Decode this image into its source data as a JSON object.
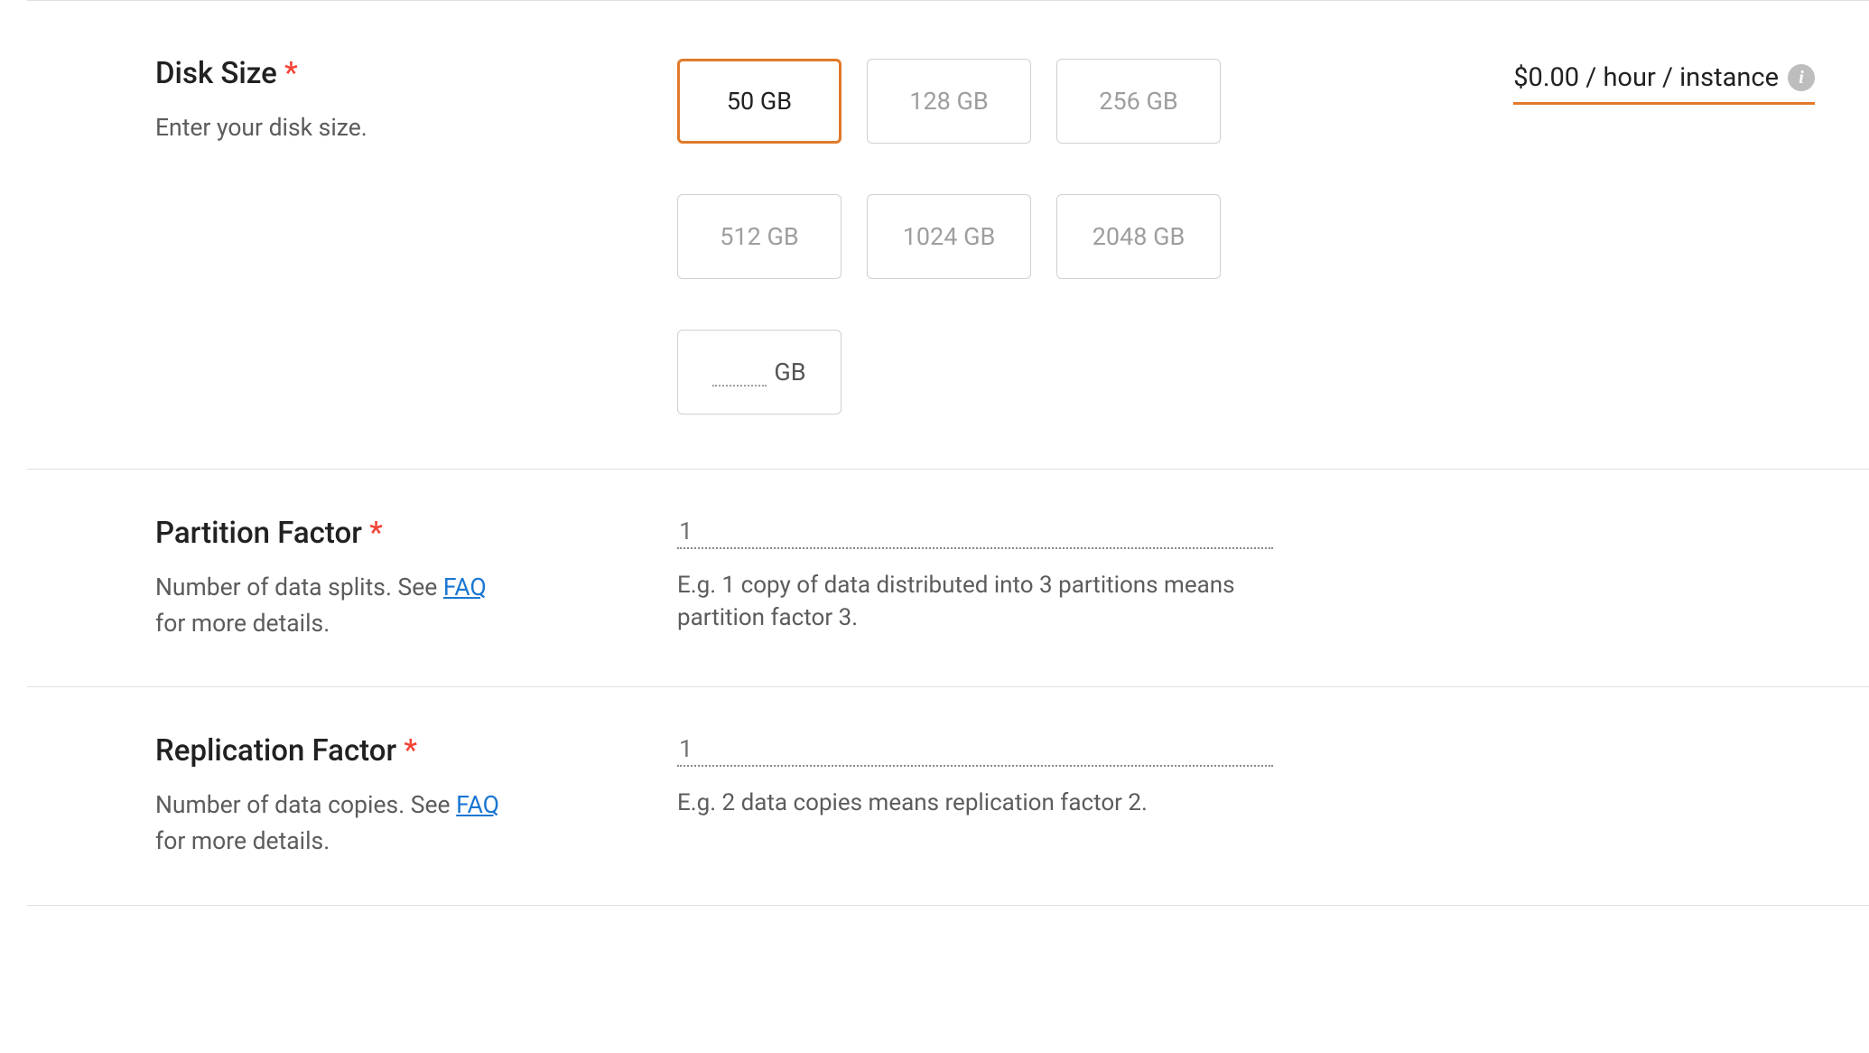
{
  "disk": {
    "title": "Disk Size",
    "required_marker": "*",
    "desc": "Enter your disk size.",
    "options": [
      "50 GB",
      "128 GB",
      "256 GB",
      "512 GB",
      "1024 GB",
      "2048 GB"
    ],
    "selected_index": 0,
    "custom_suffix": "GB",
    "price_text": "$0.00 / hour / instance",
    "info_glyph": "i"
  },
  "partition": {
    "title": "Partition Factor",
    "required_marker": "*",
    "desc_prefix": "Number of data splits. See ",
    "desc_link": "FAQ",
    "desc_suffix": " for more details.",
    "value": "1",
    "helper": "E.g. 1 copy of data distributed into 3 partitions means partition factor 3."
  },
  "replication": {
    "title": "Replication Factor",
    "required_marker": "*",
    "desc_prefix": "Number of data copies. See ",
    "desc_link": "FAQ",
    "desc_suffix": " for more details.",
    "value": "1",
    "helper": "E.g. 2 data copies means replication factor 2."
  }
}
